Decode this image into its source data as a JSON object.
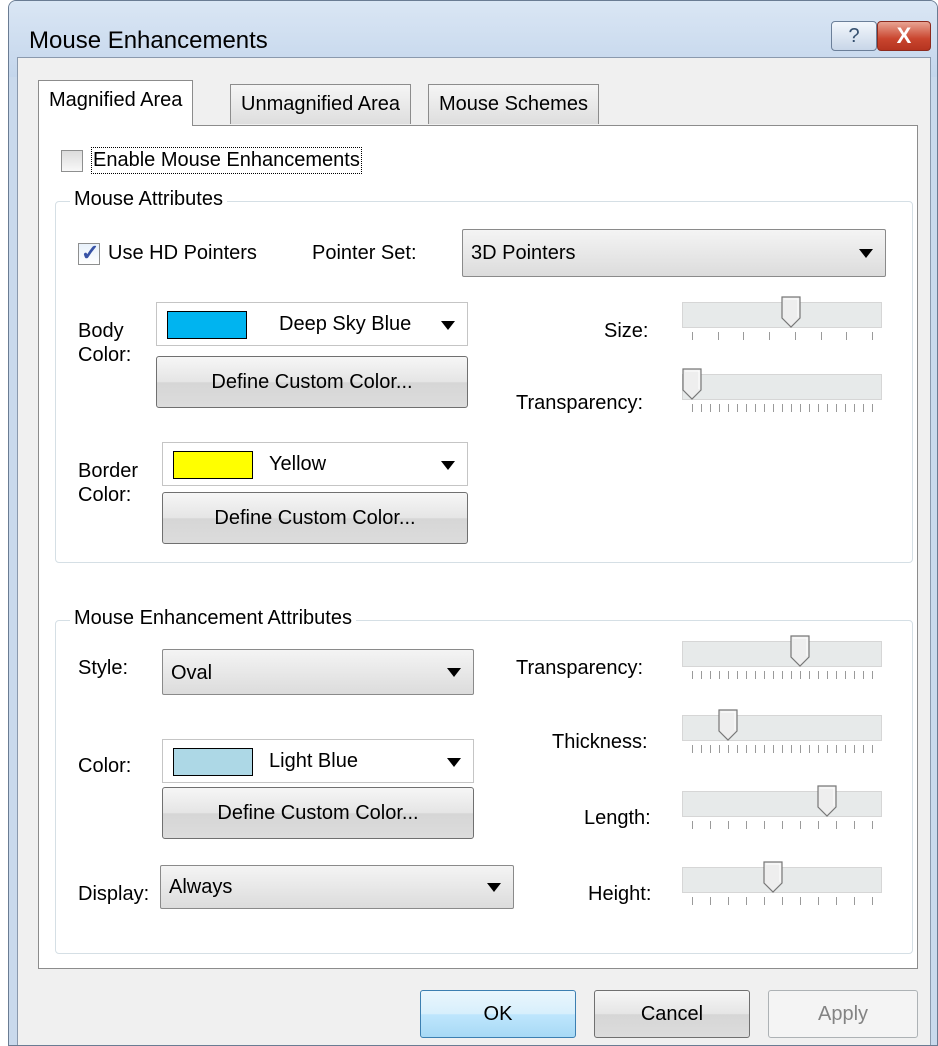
{
  "window": {
    "title": "Mouse Enhancements",
    "help_label": "?",
    "close_label": "X"
  },
  "tabs": [
    {
      "label": "Magnified Area",
      "active": true
    },
    {
      "label": "Unmagnified Area",
      "active": false
    },
    {
      "label": "Mouse Schemes",
      "active": false
    }
  ],
  "enable": {
    "label": "Enable Mouse Enhancements",
    "checked": false
  },
  "mouse_attributes": {
    "title": "Mouse Attributes",
    "use_hd": {
      "label": "Use HD Pointers",
      "checked": true
    },
    "pointer_set": {
      "label": "Pointer Set:",
      "value": "3D Pointers"
    },
    "body_color": {
      "label_line1": "Body",
      "label_line2": "Color:",
      "color_name": "Deep Sky Blue",
      "color_hex": "#00b4f0",
      "define_label": "Define Custom Color..."
    },
    "border_color": {
      "label_line1": "Border",
      "label_line2": "Color:",
      "color_name": "Yellow",
      "color_hex": "#ffff00",
      "define_label": "Define Custom Color..."
    },
    "size": {
      "label": "Size:",
      "level": 0.55,
      "ticks": 8
    },
    "transparency": {
      "label": "Transparency:",
      "level": 0.0,
      "ticks": 21
    }
  },
  "enhancement_attributes": {
    "title": "Mouse Enhancement Attributes",
    "style": {
      "label": "Style:",
      "value": "Oval"
    },
    "color": {
      "label": "Color:",
      "color_name": "Light Blue",
      "color_hex": "#add8e6",
      "define_label": "Define Custom Color..."
    },
    "display": {
      "label": "Display:",
      "value": "Always"
    },
    "transparency": {
      "label": "Transparency:",
      "level": 0.6,
      "ticks": 21
    },
    "thickness": {
      "label": "Thickness:",
      "level": 0.2,
      "ticks": 21
    },
    "length": {
      "label": "Length:",
      "level": 0.75,
      "ticks": 11
    },
    "height": {
      "label": "Height:",
      "level": 0.45,
      "ticks": 11
    }
  },
  "buttons": {
    "ok": "OK",
    "cancel": "Cancel",
    "apply": "Apply"
  }
}
